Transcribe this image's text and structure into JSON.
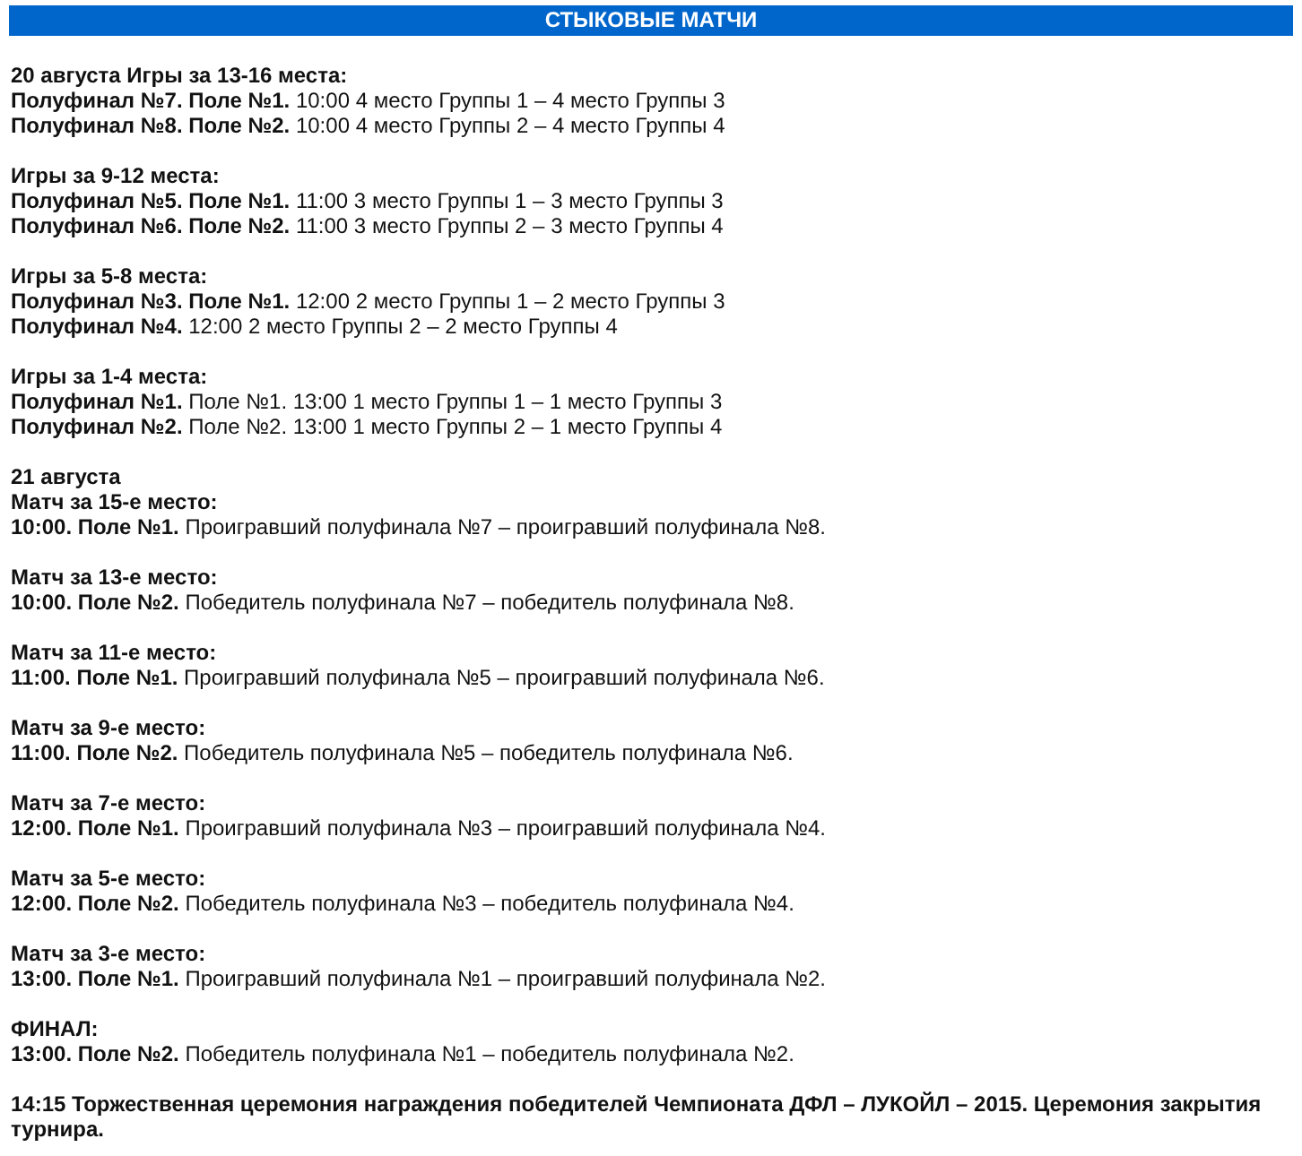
{
  "title": "СТЫКОВЫЕ МАТЧИ",
  "blocks": [
    {
      "lines": [
        {
          "kind": "heading",
          "text": "20 августа Игры за 13-16 места:"
        },
        {
          "kind": "entry",
          "text": "**Полуфинал №7. Поле №1.** 10:00 4 место Группы 1 – 4 место Группы 3"
        },
        {
          "kind": "entry",
          "text": "**Полуфинал №8. Поле №2.** 10:00 4 место Группы 2 – 4 место Группы 4"
        }
      ]
    },
    {
      "lines": [
        {
          "kind": "heading",
          "text": "Игры за 9-12 места:"
        },
        {
          "kind": "entry",
          "text": "**Полуфинал №5. Поле №1.** 11:00 3 место Группы 1 – 3 место Группы 3"
        },
        {
          "kind": "entry",
          "text": "**Полуфинал №6. Поле №2.** 11:00 3 место Группы 2 – 3 место Группы 4"
        }
      ]
    },
    {
      "lines": [
        {
          "kind": "heading",
          "text": "Игры за 5-8 места:"
        },
        {
          "kind": "entry",
          "text": "**Полуфинал №3. Поле №1.** 12:00 2 место Группы 1 – 2 место Группы 3"
        },
        {
          "kind": "entry",
          "text": "**Полуфинал №4.** 12:00 2 место Группы 2 – 2 место Группы 4"
        }
      ]
    },
    {
      "lines": [
        {
          "kind": "heading",
          "text": "Игры за 1-4 места:"
        },
        {
          "kind": "entry",
          "text": "**Полуфинал №1.** Поле №1. 13:00 1 место Группы 1 – 1 место Группы 3"
        },
        {
          "kind": "entry",
          "text": "**Полуфинал №2.** Поле №2. 13:00 1 место Группы 2 – 1 место Группы 4"
        }
      ]
    },
    {
      "lines": [
        {
          "kind": "heading",
          "text": "21 августа"
        },
        {
          "kind": "heading",
          "text": "Матч за 15-е место:"
        },
        {
          "kind": "entry",
          "text": "**10:00. Поле №1.** Проигравший полуфинала №7 – проигравший полуфинала №8."
        }
      ]
    },
    {
      "lines": [
        {
          "kind": "heading",
          "text": "Матч за 13-е место:"
        },
        {
          "kind": "entry",
          "text": "**10:00. Поле №2.** Победитель полуфинала №7 – победитель полуфинала №8."
        }
      ]
    },
    {
      "lines": [
        {
          "kind": "heading",
          "text": "Матч за 11-е место:"
        },
        {
          "kind": "entry",
          "text": "**11:00. Поле №1.** Проигравший полуфинала №5 – проигравший полуфинала №6."
        }
      ]
    },
    {
      "lines": [
        {
          "kind": "heading",
          "text": "Матч за 9-е место:"
        },
        {
          "kind": "entry",
          "text": "**11:00. Поле №2.** Победитель полуфинала №5 – победитель полуфинала №6."
        }
      ]
    },
    {
      "lines": [
        {
          "kind": "heading",
          "text": "Матч за 7-е место:"
        },
        {
          "kind": "entry",
          "text": "**12:00. Поле №1.** Проигравший полуфинала №3 – проигравший полуфинала №4."
        }
      ]
    },
    {
      "lines": [
        {
          "kind": "heading",
          "text": "Матч за 5-е место:"
        },
        {
          "kind": "entry",
          "text": "**12:00. Поле №2.** Победитель полуфинала №3 – победитель полуфинала №4."
        }
      ]
    },
    {
      "lines": [
        {
          "kind": "heading",
          "text": "Матч за 3-е место:"
        },
        {
          "kind": "entry",
          "text": "**13:00. Поле №1.** Проигравший полуфинала №1 – проигравший полуфинала №2."
        }
      ]
    },
    {
      "lines": [
        {
          "kind": "heading",
          "text": "ФИНАЛ:"
        },
        {
          "kind": "entry",
          "text": "**13:00. Поле №2.** Победитель полуфинала №1 – победитель полуфинала №2."
        }
      ]
    },
    {
      "lines": [
        {
          "kind": "heading",
          "text": "14:15 Торжественная церемония награждения победителей Чемпионата ДФЛ – ЛУКОЙЛ – 2015. Церемония закрытия турнира."
        }
      ]
    }
  ]
}
